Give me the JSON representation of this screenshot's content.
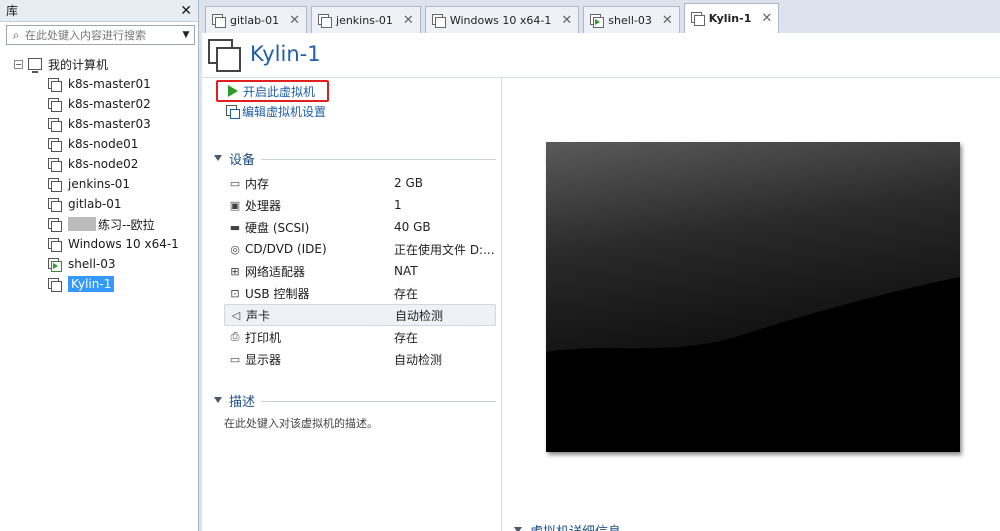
{
  "library": {
    "title": "库",
    "search_placeholder": "在此处键入内容进行搜索",
    "root_label": "我的计算机",
    "items": [
      {
        "label": "k8s-master01",
        "running": false
      },
      {
        "label": "k8s-master02",
        "running": false
      },
      {
        "label": "k8s-master03",
        "running": false
      },
      {
        "label": "k8s-node01",
        "running": false
      },
      {
        "label": "k8s-node02",
        "running": false
      },
      {
        "label": "jenkins-01",
        "running": false
      },
      {
        "label": "gitlab-01",
        "running": false
      },
      {
        "label": "练习--欧拉",
        "running": false
      },
      {
        "label": "Windows 10 x64-1",
        "running": false
      },
      {
        "label": "shell-03",
        "running": true
      },
      {
        "label": "Kylin-1",
        "running": false,
        "selected": true
      }
    ]
  },
  "tabs": [
    {
      "label": "gitlab-01"
    },
    {
      "label": "jenkins-01"
    },
    {
      "label": "Windows 10 x64-1"
    },
    {
      "label": "shell-03",
      "running": true
    },
    {
      "label": "Kylin-1",
      "active": true
    }
  ],
  "vm": {
    "title": "Kylin-1",
    "start_label": "开启此虚拟机",
    "edit_label": "编辑虚拟机设置"
  },
  "devices": {
    "section_title": "设备",
    "rows": [
      {
        "name": "内存",
        "value": "2 GB",
        "icon": "memory-icon",
        "glyph": "▭"
      },
      {
        "name": "处理器",
        "value": "1",
        "icon": "cpu-icon",
        "glyph": "▣"
      },
      {
        "name": "硬盘 (SCSI)",
        "value": "40 GB",
        "icon": "hdd-icon",
        "glyph": "▬"
      },
      {
        "name": "CD/DVD (IDE)",
        "value": "正在使用文件 D:...",
        "icon": "cdrom-icon",
        "glyph": "◎"
      },
      {
        "name": "网络适配器",
        "value": "NAT",
        "icon": "network-icon",
        "glyph": "⊞"
      },
      {
        "name": "USB 控制器",
        "value": "存在",
        "icon": "usb-icon",
        "glyph": "⊡"
      },
      {
        "name": "声卡",
        "value": "自动检测",
        "icon": "sound-icon",
        "glyph": "◁",
        "highlight": true
      },
      {
        "name": "打印机",
        "value": "存在",
        "icon": "printer-icon",
        "glyph": "⎙"
      },
      {
        "name": "显示器",
        "value": "自动检测",
        "icon": "display-icon",
        "glyph": "▭"
      }
    ]
  },
  "description": {
    "section_title": "描述",
    "placeholder": "在此处键入对该虚拟机的描述。"
  },
  "details": {
    "section_title": "虚拟机详细信息"
  }
}
